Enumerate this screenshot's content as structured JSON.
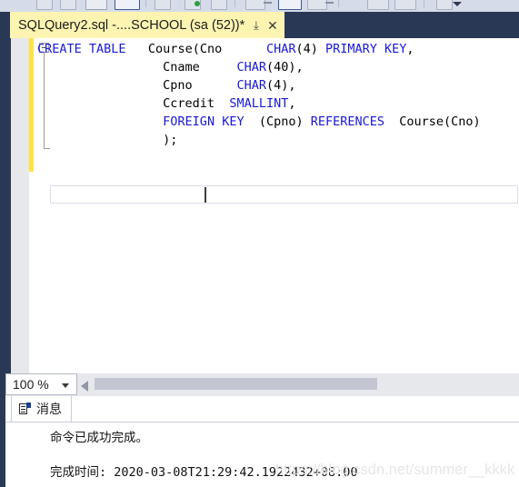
{
  "toolbar": {
    "chevron_label": "",
    "buttons": [
      "new-query-button",
      "open-file-button",
      "save-button",
      "save-all-button",
      "execute-button",
      "parse-button",
      "debug-button",
      "stop-button",
      "results-to-grid-button",
      "results-to-text-button",
      "results-to-file-button",
      "include-plan-button",
      "comment-button"
    ]
  },
  "tab": {
    "title": "SQLQuery2.sql -....SCHOOL (sa (52))*",
    "pin_glyph": "⤓",
    "close_glyph": "✕"
  },
  "editor": {
    "lines": [
      [
        {
          "t": "CREATE TABLE ",
          "k": true
        },
        {
          "t": "  Course(Cno      ",
          "k": false
        },
        {
          "t": "CHAR",
          "k": true
        },
        {
          "t": "(4) ",
          "k": false
        },
        {
          "t": "PRIMARY KEY",
          "k": true
        },
        {
          "t": ",",
          "k": false
        }
      ],
      [
        {
          "t": "                 Cname     ",
          "k": false
        },
        {
          "t": "CHAR",
          "k": true
        },
        {
          "t": "(40),",
          "k": false
        }
      ],
      [
        {
          "t": "                 Cpno      ",
          "k": false
        },
        {
          "t": "CHAR",
          "k": true
        },
        {
          "t": "(4),",
          "k": false
        }
      ],
      [
        {
          "t": "                 Ccredit  ",
          "k": false
        },
        {
          "t": "SMALLINT",
          "k": true
        },
        {
          "t": ",",
          "k": false
        }
      ],
      [
        {
          "t": "                 ",
          "k": false
        },
        {
          "t": "FOREIGN KEY",
          "k": true
        },
        {
          "t": "  (Cpno) ",
          "k": false
        },
        {
          "t": "REFERENCES",
          "k": true
        },
        {
          "t": "  Course(Cno)",
          "k": false
        }
      ],
      [
        {
          "t": "                 );",
          "k": false
        }
      ]
    ],
    "fold_state": "expanded"
  },
  "zoom": {
    "value": "100 %"
  },
  "results": {
    "tab_label": "消息",
    "message_line_1": "命令已成功完成。",
    "message_line_2": "完成时间: 2020-03-08T21:29:42.1922432+08:00"
  },
  "watermark": {
    "text": "https://blog.csdn.net/summer__kkkk"
  },
  "colors": {
    "keyword": "#1a19d6",
    "tab_active_bg": "#fdf4b2",
    "chrome_dark": "#293955",
    "change_bar": "#ffe242"
  }
}
